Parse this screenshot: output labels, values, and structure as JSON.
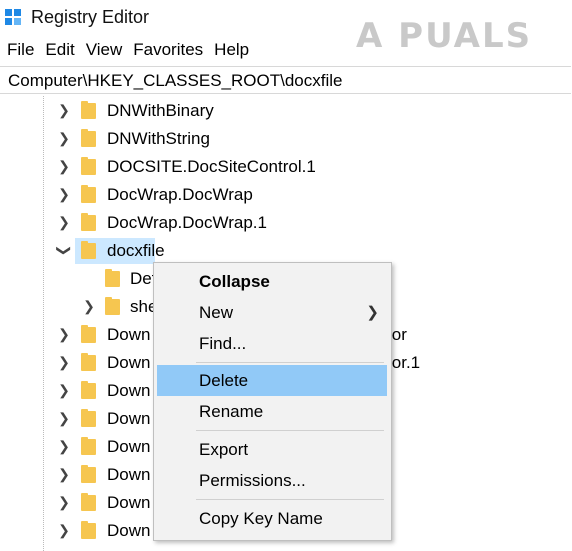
{
  "window": {
    "title": "Registry Editor",
    "watermark": "A  PUALS"
  },
  "menu": [
    "File",
    "Edit",
    "View",
    "Favorites",
    "Help"
  ],
  "address": "Computer\\HKEY_CLASSES_ROOT\\docxfile",
  "tree": {
    "items": [
      {
        "label": "DNWithBinary"
      },
      {
        "label": "DNWithString"
      },
      {
        "label": "DOCSITE.DocSiteControl.1"
      },
      {
        "label": "DocWrap.DocWrap"
      },
      {
        "label": "DocWrap.DocWrap.1"
      },
      {
        "label": "docxfile"
      },
      {
        "label": "Det"
      },
      {
        "label": "she"
      },
      {
        "label": "Down",
        "tail": "ior"
      },
      {
        "label": "Down",
        "tail": "ior.1"
      },
      {
        "label": "Down"
      },
      {
        "label": "Down"
      },
      {
        "label": "Down"
      },
      {
        "label": "Down"
      },
      {
        "label": "Down"
      },
      {
        "label": "Down"
      }
    ]
  },
  "context_menu": {
    "collapse": "Collapse",
    "new": "New",
    "find": "Find...",
    "delete": "Delete",
    "rename": "Rename",
    "export": "Export",
    "permissions": "Permissions...",
    "copy_key_name": "Copy Key Name"
  },
  "colors": {
    "highlight": "#91c9f7",
    "selection": "#cce8ff",
    "folder": "#f6c650"
  }
}
